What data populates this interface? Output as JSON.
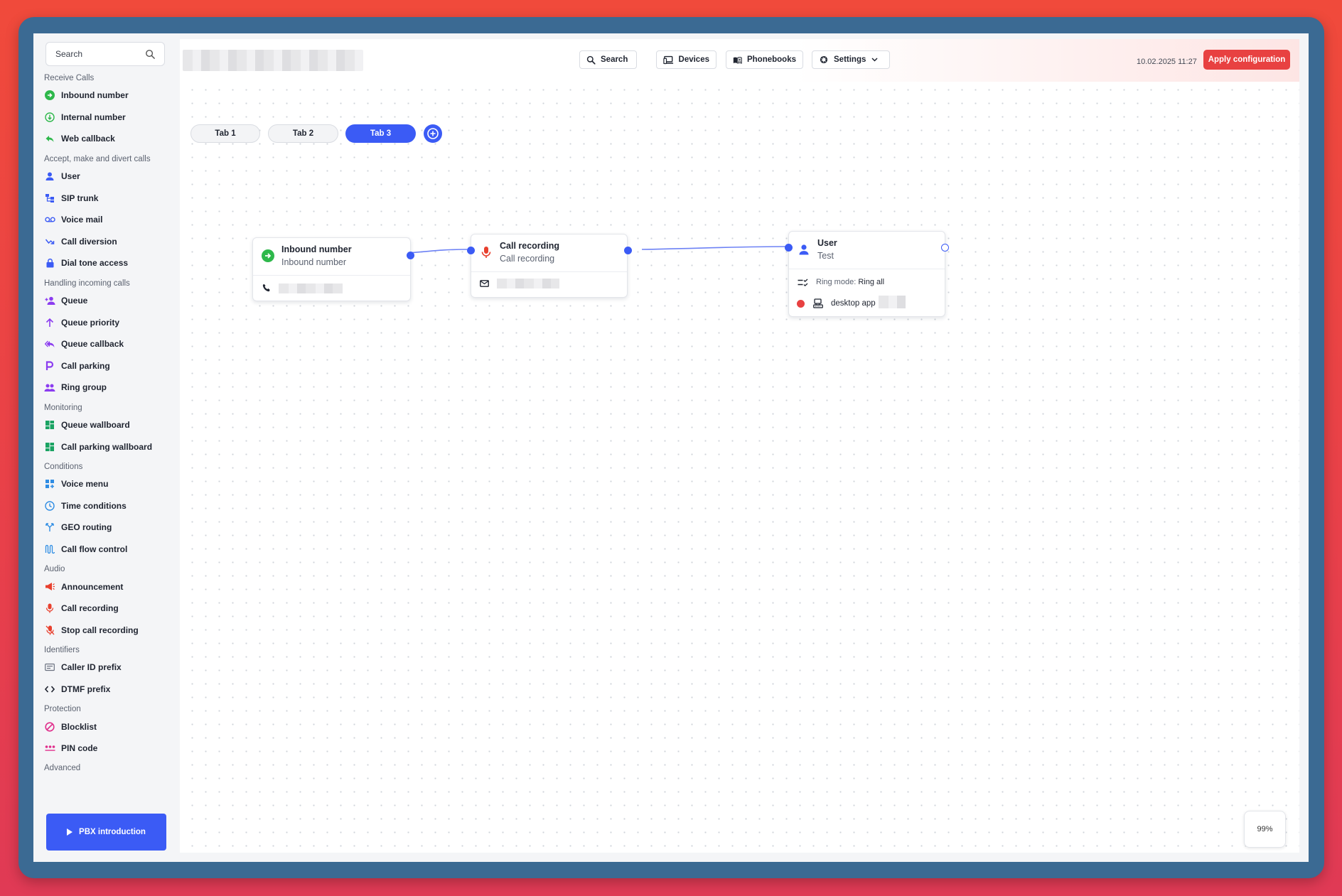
{
  "sidebar": {
    "search_placeholder": "Search",
    "sections": [
      {
        "title": "Receive Calls",
        "items": [
          {
            "label": "Inbound number",
            "icon": "inbound-arrow-icon"
          },
          {
            "label": "Internal number",
            "icon": "internal-arrow-icon"
          },
          {
            "label": "Web callback",
            "icon": "reply-icon"
          }
        ]
      },
      {
        "title": "Accept, make and divert calls",
        "items": [
          {
            "label": "User",
            "icon": "user-icon"
          },
          {
            "label": "SIP trunk",
            "icon": "sip-trunk-icon"
          },
          {
            "label": "Voice mail",
            "icon": "voicemail-icon"
          },
          {
            "label": "Call diversion",
            "icon": "call-diversion-icon"
          },
          {
            "label": "Dial tone access",
            "icon": "lock-icon"
          }
        ]
      },
      {
        "title": "Handling incoming calls",
        "items": [
          {
            "label": "Queue",
            "icon": "queue-icon"
          },
          {
            "label": "Queue priority",
            "icon": "arrow-up-icon"
          },
          {
            "label": "Queue callback",
            "icon": "reply-all-icon"
          },
          {
            "label": "Call parking",
            "icon": "parking-icon"
          },
          {
            "label": "Ring group",
            "icon": "group-icon"
          }
        ]
      },
      {
        "title": "Monitoring",
        "items": [
          {
            "label": "Queue wallboard",
            "icon": "dashboard-icon"
          },
          {
            "label": "Call parking wallboard",
            "icon": "dashboard-icon"
          }
        ]
      },
      {
        "title": "Conditions",
        "items": [
          {
            "label": "Voice menu",
            "icon": "grid-plus-icon"
          },
          {
            "label": "Time conditions",
            "icon": "clock-icon"
          },
          {
            "label": "GEO routing",
            "icon": "fork-icon"
          },
          {
            "label": "Call flow control",
            "icon": "flow-icon"
          }
        ]
      },
      {
        "title": "Audio",
        "items": [
          {
            "label": "Announcement",
            "icon": "megaphone-icon"
          },
          {
            "label": "Call recording",
            "icon": "microphone-icon"
          },
          {
            "label": "Stop call recording",
            "icon": "microphone-off-icon"
          }
        ]
      },
      {
        "title": "Identifiers",
        "items": [
          {
            "label": "Caller ID prefix",
            "icon": "id-prefix-icon"
          },
          {
            "label": "DTMF prefix",
            "icon": "code-icon"
          }
        ]
      },
      {
        "title": "Protection",
        "items": [
          {
            "label": "Blocklist",
            "icon": "block-icon"
          },
          {
            "label": "PIN code",
            "icon": "pin-dots-icon"
          }
        ]
      },
      {
        "title": "Advanced",
        "items": []
      }
    ],
    "intro_button": "PBX introduction"
  },
  "topbar": {
    "search": "Search",
    "devices": "Devices",
    "phonebooks": "Phonebooks",
    "settings": "Settings",
    "datetime": "10.02.2025 11:27",
    "apply": "Apply configuration"
  },
  "tabs": [
    "Tab 1",
    "Tab 2",
    "Tab 3"
  ],
  "active_tab": "Tab 3",
  "nodes": {
    "inbound": {
      "title": "Inbound number",
      "subtitle": "Inbound number"
    },
    "recording": {
      "title": "Call recording",
      "subtitle": "Call recording"
    },
    "user": {
      "title": "User",
      "subtitle": "Test",
      "ring_mode_label": "Ring mode:",
      "ring_mode_value": "Ring all",
      "device": "desktop app"
    }
  },
  "zoom": "99%",
  "colors": {
    "accent": "#3b5bf5",
    "danger": "#e84141"
  }
}
